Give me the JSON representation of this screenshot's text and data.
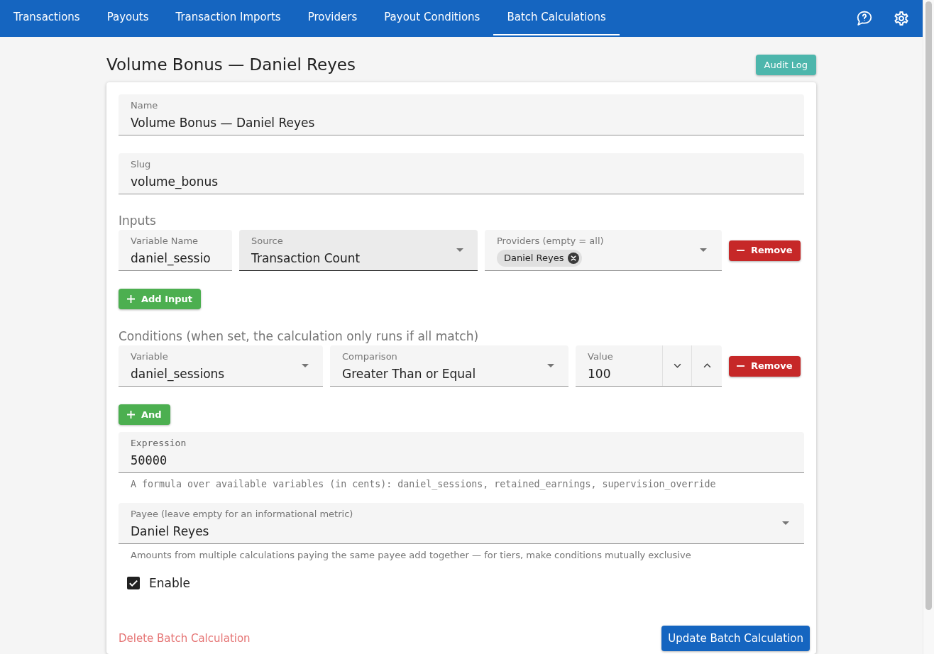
{
  "nav": {
    "tabs": [
      {
        "label": "Transactions",
        "selected": false
      },
      {
        "label": "Payouts",
        "selected": false
      },
      {
        "label": "Transaction Imports",
        "selected": false
      },
      {
        "label": "Providers",
        "selected": false
      },
      {
        "label": "Payout Conditions",
        "selected": false
      },
      {
        "label": "Batch Calculations",
        "selected": true
      }
    ]
  },
  "header": {
    "title": "Volume Bonus — Daniel Reyes",
    "audit_button": "Audit Log"
  },
  "form": {
    "name": {
      "label": "Name",
      "value": "Volume Bonus — Daniel Reyes"
    },
    "slug": {
      "label": "Slug",
      "value": "volume_bonus"
    },
    "inputs": {
      "heading": "Inputs",
      "rows": [
        {
          "variable_name": {
            "label": "Variable Name",
            "value": "daniel_sessio"
          },
          "source": {
            "label": "Source",
            "value": "Transaction Count",
            "hovered": true
          },
          "providers": {
            "label": "Providers (empty = all)",
            "chips": [
              "Daniel Reyes"
            ]
          },
          "remove_button": "Remove"
        }
      ],
      "add_button": "Add Input"
    },
    "conditions": {
      "heading": "Conditions (when set, the calculation only runs if all match)",
      "rows": [
        {
          "variable": {
            "label": "Variable",
            "value": "daniel_sessions"
          },
          "comparison": {
            "label": "Comparison",
            "value": "Greater Than or Equal"
          },
          "value": {
            "label": "Value",
            "value": "100"
          },
          "remove_button": "Remove"
        }
      ],
      "add_button": "And"
    },
    "expression": {
      "label": "Expression",
      "value": "50000",
      "helper": "A formula over available variables (in cents): daniel_sessions, retained_earnings, supervision_override"
    },
    "payee": {
      "label": "Payee (leave empty for an informational metric)",
      "value": "Daniel Reyes",
      "helper": "Amounts from multiple calculations paying the same payee add together — for tiers, make conditions mutually exclusive"
    },
    "enable": {
      "label": "Enable",
      "checked": true
    },
    "delete_link": "Delete Batch Calculation",
    "submit_button": "Update Batch Calculation"
  }
}
